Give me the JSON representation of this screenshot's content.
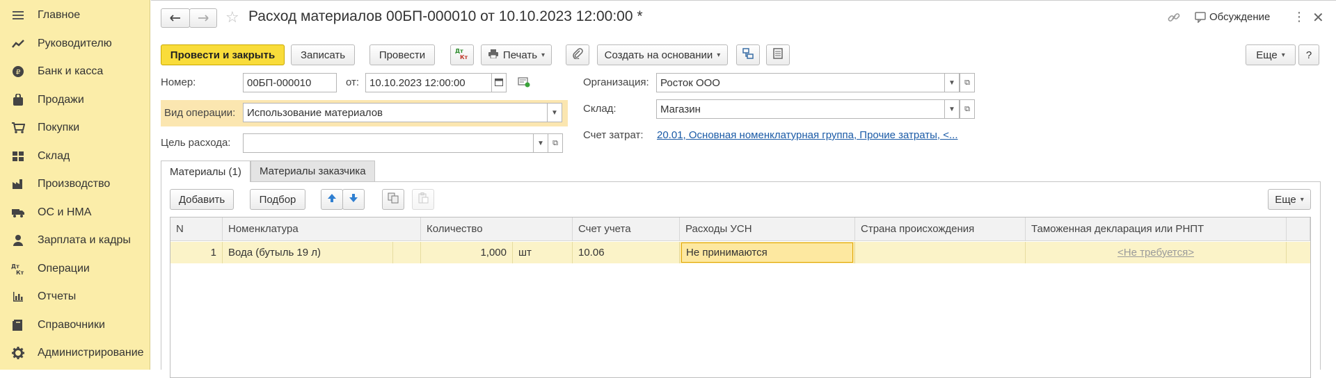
{
  "sidebar": {
    "items": [
      {
        "label": "Главное",
        "icon": "menu-icon"
      },
      {
        "label": "Руководителю",
        "icon": "trend-icon"
      },
      {
        "label": "Банк и касса",
        "icon": "coin-icon"
      },
      {
        "label": "Продажи",
        "icon": "bag-icon"
      },
      {
        "label": "Покупки",
        "icon": "cart-icon"
      },
      {
        "label": "Склад",
        "icon": "warehouse-icon"
      },
      {
        "label": "Производство",
        "icon": "factory-icon"
      },
      {
        "label": "ОС и НМА",
        "icon": "truck-icon"
      },
      {
        "label": "Зарплата и кадры",
        "icon": "person-icon"
      },
      {
        "label": "Операции",
        "icon": "dt-kt-icon"
      },
      {
        "label": "Отчеты",
        "icon": "bar-chart-icon"
      },
      {
        "label": "Справочники",
        "icon": "book-icon"
      },
      {
        "label": "Администрирование",
        "icon": "gear-icon"
      }
    ]
  },
  "header": {
    "title": "Расход материалов 00БП-000010 от 10.10.2023 12:00:00 *",
    "discussion_label": "Обсуждение"
  },
  "toolbar": {
    "post_close": "Провести и закрыть",
    "save": "Записать",
    "post": "Провести",
    "dtkt": "Дт Кт",
    "print": "Печать",
    "create_based": "Создать на основании",
    "more": "Еще",
    "help": "?"
  },
  "form": {
    "number_label": "Номер:",
    "number_value": "00БП-000010",
    "date_label": "от:",
    "date_value": "10.10.2023 12:00:00",
    "operation_label": "Вид операции:",
    "operation_value": "Использование материалов",
    "purpose_label": "Цель расхода:",
    "purpose_value": "",
    "org_label": "Организация:",
    "org_value": "Росток ООО",
    "warehouse_label": "Склад:",
    "warehouse_value": "Магазин",
    "cost_account_label": "Счет затрат:",
    "cost_account_value": "20.01, Основная номенклатурная группа, Прочие затраты, <..."
  },
  "tabs": [
    {
      "label": "Материалы (1)",
      "active": true
    },
    {
      "label": "Материалы заказчика",
      "active": false
    }
  ],
  "table_toolbar": {
    "add": "Добавить",
    "pick": "Подбор",
    "more": "Еще"
  },
  "table": {
    "columns": [
      "N",
      "Номенклатура",
      "Количество",
      "Счет учета",
      "Расходы УСН",
      "Страна происхождения",
      "Таможенная декларация или РНПТ"
    ],
    "rows": [
      {
        "n": "1",
        "item": "Вода (бутыль 19 л)",
        "qty": "1,000",
        "unit": "шт",
        "account": "10.06",
        "usn": "Не принимаются",
        "country": "",
        "customs": "<Не требуется>"
      }
    ]
  }
}
